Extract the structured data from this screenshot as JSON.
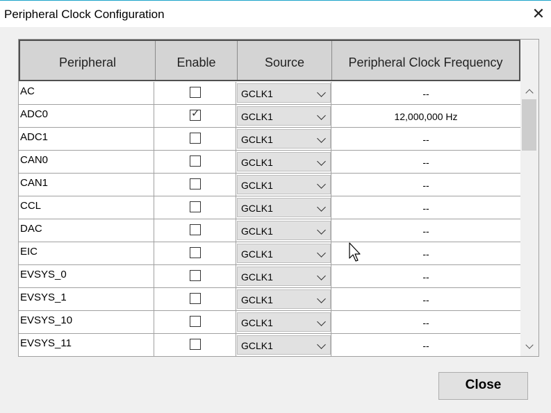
{
  "window": {
    "title": "Peripheral Clock Configuration",
    "close_glyph": "✕"
  },
  "table": {
    "columns": [
      "Peripheral",
      "Enable",
      "Source",
      "Peripheral Clock Frequency"
    ],
    "rows": [
      {
        "peripheral": "AC",
        "enabled": false,
        "source": "GCLK1",
        "frequency": "--"
      },
      {
        "peripheral": "ADC0",
        "enabled": true,
        "source": "GCLK1",
        "frequency": "12,000,000 Hz"
      },
      {
        "peripheral": "ADC1",
        "enabled": false,
        "source": "GCLK1",
        "frequency": "--"
      },
      {
        "peripheral": "CAN0",
        "enabled": false,
        "source": "GCLK1",
        "frequency": "--"
      },
      {
        "peripheral": "CAN1",
        "enabled": false,
        "source": "GCLK1",
        "frequency": "--"
      },
      {
        "peripheral": "CCL",
        "enabled": false,
        "source": "GCLK1",
        "frequency": "--"
      },
      {
        "peripheral": "DAC",
        "enabled": false,
        "source": "GCLK1",
        "frequency": "--"
      },
      {
        "peripheral": "EIC",
        "enabled": false,
        "source": "GCLK1",
        "frequency": "--"
      },
      {
        "peripheral": "EVSYS_0",
        "enabled": false,
        "source": "GCLK1",
        "frequency": "--"
      },
      {
        "peripheral": "EVSYS_1",
        "enabled": false,
        "source": "GCLK1",
        "frequency": "--"
      },
      {
        "peripheral": "EVSYS_10",
        "enabled": false,
        "source": "GCLK1",
        "frequency": "--"
      },
      {
        "peripheral": "EVSYS_11",
        "enabled": false,
        "source": "GCLK1",
        "frequency": "--"
      }
    ]
  },
  "buttons": {
    "close_label": "Close"
  },
  "icons": {
    "check": "check-icon",
    "dropdown": "chevron-down-icon",
    "cursor": "mouse-pointer-icon"
  },
  "colors": {
    "title_accent": "#1aa3c9",
    "header_bg": "#d4d4d4"
  }
}
